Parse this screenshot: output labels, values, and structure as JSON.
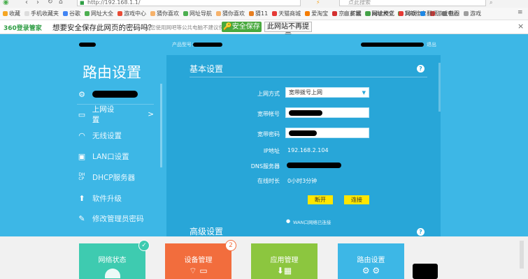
{
  "browser": {
    "url": "http://192.168.1.1/",
    "search_placeholder": "点此搜索",
    "bookmarks": [
      "收藏",
      "手机收藏夹",
      "谷歌",
      "网址大全",
      "游戏中心",
      "猜你喜欢",
      "网址导航",
      "猜你喜欢",
      "猜11",
      "天猫商城",
      "爱淘宝",
      "京东商城",
      "网址大全",
      "360搜索",
      "游戏中心"
    ],
    "extensions": [
      "扩展",
      "阅读模式",
      "网银",
      "翻译",
      "截图",
      "游戏"
    ],
    "save_prompt": {
      "brand": "360登录管家",
      "question": "想要安全保存此网页的密码吗？",
      "hint": "（若您使用网吧等公共电脑不建议保存）",
      "save_button": "安全保存",
      "never_button": "此网站不再提示",
      "close": "×"
    }
  },
  "router": {
    "product_label": "产品型号：",
    "logout_label": "退出",
    "sidebar": {
      "title": "路由设置",
      "items": [
        {
          "label": "上网设置",
          "arrow": ">"
        },
        {
          "label": "无线设置"
        },
        {
          "label": "LAN口设置"
        },
        {
          "label": "DHCP服务器"
        },
        {
          "label": "软件升级"
        },
        {
          "label": "修改管理员密码"
        }
      ]
    },
    "basic": {
      "title": "基本设置",
      "help": "?",
      "rows": [
        {
          "label": "上网方式",
          "value": "宽带拨号上网"
        },
        {
          "label": "宽带帐号",
          "value": ""
        },
        {
          "label": "宽带密码",
          "value": ""
        },
        {
          "label": "IP地址",
          "value": "192.168.2.104"
        },
        {
          "label": "DNS服务器",
          "value": ""
        },
        {
          "label": "在线时长",
          "value": "0小时3分钟"
        }
      ],
      "connect_button": "断开",
      "reconnect_button": "连接",
      "wan_note": "WAN口网络已连接"
    },
    "advanced": {
      "title": "高级设置",
      "help": "?"
    },
    "dock": [
      {
        "label": "网络状态",
        "color": "#3ecbb0",
        "badge": "✓"
      },
      {
        "label": "设备管理",
        "color": "#f26d3d",
        "badge": "2"
      },
      {
        "label": "应用管理",
        "color": "#8cc63f"
      },
      {
        "label": "路由设置",
        "color": "#3db7e6"
      }
    ]
  }
}
